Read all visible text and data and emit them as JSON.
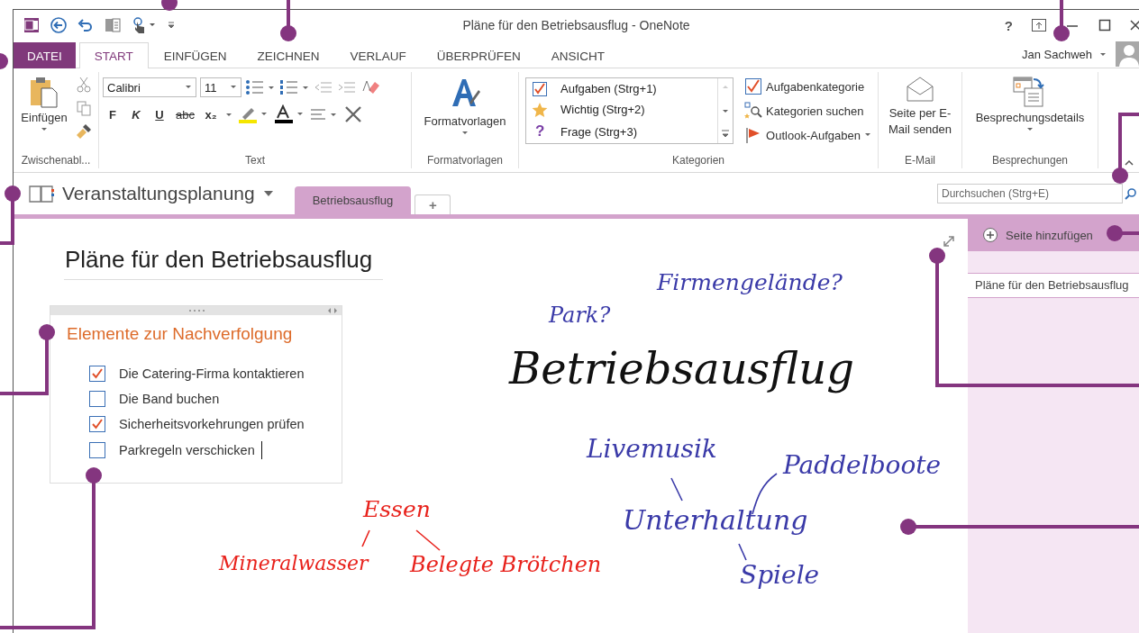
{
  "window": {
    "title": "Pläne für den Betriebsausflug - OneNote",
    "help": "?"
  },
  "ribbon_tabs": [
    {
      "label": "DATEI",
      "kind": "file",
      "selected": false
    },
    {
      "label": "START",
      "kind": "tab",
      "selected": true
    },
    {
      "label": "EINFÜGEN",
      "kind": "tab",
      "selected": false
    },
    {
      "label": "ZEICHNEN",
      "kind": "tab",
      "selected": false
    },
    {
      "label": "VERLAUF",
      "kind": "tab",
      "selected": false
    },
    {
      "label": "ÜBERPRÜFEN",
      "kind": "tab",
      "selected": false
    },
    {
      "label": "ANSICHT",
      "kind": "tab",
      "selected": false
    }
  ],
  "user": {
    "name": "Jan Sachweh"
  },
  "clipboard": {
    "paste": "Einfügen",
    "label": "Zwischenabl..."
  },
  "text_group": {
    "font": "Calibri",
    "size": "11",
    "format_buttons": [
      "F",
      "K",
      "U",
      "abc",
      "x₂"
    ],
    "label": "Text"
  },
  "styles": {
    "button": "Formatvorlagen",
    "label": "Formatvorlagen"
  },
  "tags": {
    "items": [
      {
        "label": "Aufgaben (Strg+1)",
        "kind": "todo"
      },
      {
        "label": "Wichtig (Strg+2)",
        "kind": "star"
      },
      {
        "label": "Frage (Strg+3)",
        "kind": "question",
        "symbol": "?"
      }
    ],
    "actions": [
      {
        "label": "Aufgabenkategorie",
        "kind": "check"
      },
      {
        "label": "Kategorien suchen",
        "kind": "find"
      },
      {
        "label": "Outlook-Aufgaben",
        "kind": "flag"
      }
    ],
    "label": "Kategorien"
  },
  "email": {
    "button": "Seite per E-Mail senden",
    "label": "E-Mail"
  },
  "meetings": {
    "button": "Besprechungsdetails",
    "label": "Besprechungen"
  },
  "notebook": {
    "name": "Veranstaltungsplanung",
    "sections": [
      {
        "label": "Betriebsausflug",
        "selected": true
      }
    ],
    "add": "+"
  },
  "search": {
    "placeholder": "Durchsuchen (Strg+E)"
  },
  "page": {
    "title": "Pläne für den Betriebsausflug",
    "note": {
      "heading": "Elemente zur Nachverfolgung",
      "todos": [
        {
          "text": "Die Catering-Firma kontaktieren",
          "checked": true
        },
        {
          "text": "Die Band buchen",
          "checked": false
        },
        {
          "text": "Sicherheitsvorkehrungen prüfen",
          "checked": true
        },
        {
          "text": "Parkregeln verschicken",
          "checked": false
        }
      ]
    },
    "handwriting": [
      {
        "text": "Park?",
        "color": "#3a3aa8"
      },
      {
        "text": "Firmengelände?",
        "color": "#3a3aa8"
      },
      {
        "text": "Betriebsausflug",
        "color": "#111111"
      },
      {
        "text": "Livemusik",
        "color": "#3a3aa8"
      },
      {
        "text": "Paddelboote",
        "color": "#3a3aa8"
      },
      {
        "text": "Unterhaltung",
        "color": "#3a3aa8"
      },
      {
        "text": "Spiele",
        "color": "#3a3aa8"
      },
      {
        "text": "Essen",
        "color": "#e8221c"
      },
      {
        "text": "Mineralwasser",
        "color": "#e8221c"
      },
      {
        "text": "Belegte Brötchen",
        "color": "#e8221c"
      }
    ]
  },
  "pages_panel": {
    "add": "Seite hinzufügen",
    "pages": [
      {
        "title": "Pläne für den Betriebsausflug",
        "selected": false
      }
    ]
  }
}
